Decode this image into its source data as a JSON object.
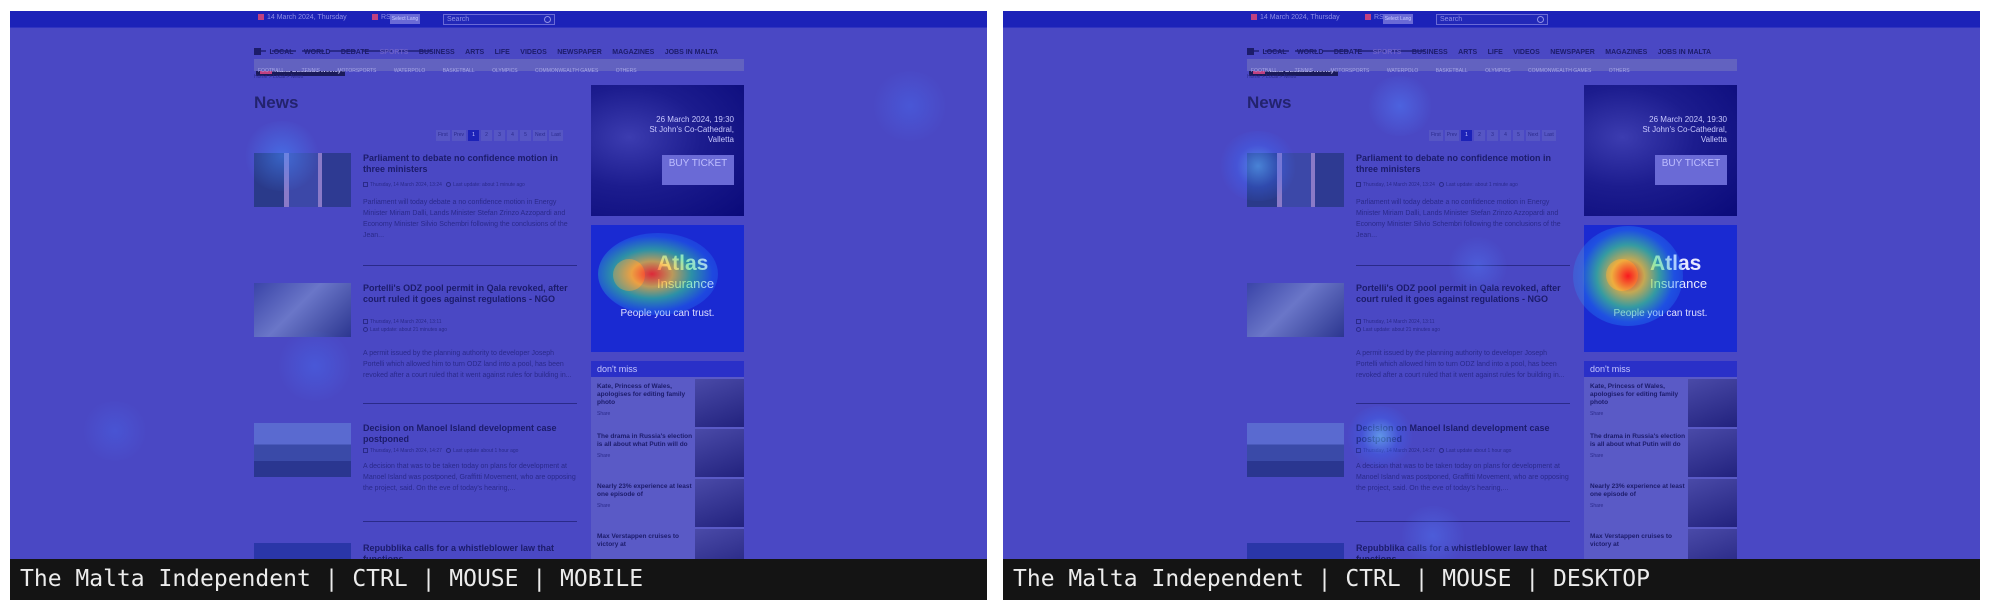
{
  "site": {
    "topbar": {
      "date": "14 March 2024, Thursday",
      "rss": "RSS",
      "translate": "Select Lang",
      "search_placeholder": "Search"
    },
    "nav": {
      "items": [
        "LOCAL",
        "WORLD",
        "DEBATE",
        "SPORTS",
        "BUSINESS",
        "ARTS",
        "LIFE",
        "VIDEOS",
        "NEWSPAPER",
        "MAGAZINES",
        "JOBS IN MALTA"
      ],
      "promo": "Malta Business Weekly"
    },
    "subnav": [
      "FOOTBALL",
      "TENNIS",
      "MOTORSPORTS",
      "WATERPOLO",
      "BASKETBALL",
      "OLYMPICS",
      "COMMONWEALTH GAMES",
      "OTHERS"
    ],
    "breadcrumb": "Home > Local > News",
    "heading": "News",
    "pager": [
      "First",
      "Prev",
      "1",
      "2",
      "3",
      "4",
      "5",
      "Next",
      "Last"
    ],
    "pager_current": "1",
    "articles": [
      {
        "title": "Parliament to debate no confidence motion in three ministers",
        "date": "Thursday, 14 March 2024, 13:24",
        "updated": "Last update: about 1 minute ago",
        "lead": "Parliament will today debate a no confidence motion in Energy Minister Miriam Dalli, Lands Minister Stefan Zrinzo Azzopardi and Economy Minister Silvio Schembri following the conclusions of the Jean..."
      },
      {
        "title": "Portelli's ODZ pool permit in Qala revoked, after court ruled it goes against regulations - NGO",
        "date": "Thursday, 14 March 2024, 13:11",
        "updated": "Last update: about 21 minutes ago",
        "lead": "A permit issued by the planning authority to developer Joseph Portelli which allowed him to turn ODZ land into a pool, has been revoked after a court ruled that it went against rules for building in..."
      },
      {
        "title": "Decision on Manoel Island development case postponed",
        "date": "Thursday, 14 March 2024, 14:27",
        "updated": "Last update about 1 hour ago",
        "lead": "A decision that was to be taken today on plans for development at Manoel Island was postponed, Graffitti Movement, who are opposing the project, said. On the eve of today's hearing,..."
      },
      {
        "title": "Repubblika calls for a whistleblower law that functions",
        "date": "",
        "updated": "",
        "lead": ""
      }
    ],
    "ad_concert": {
      "date": "26 March 2024, 19:30",
      "venue": "St John's Co-Cathedral, Valletta",
      "button": "BUY TICKET"
    },
    "ad_insurance": {
      "brand": "Atlas",
      "brand_sub": "Insurance",
      "tagline": "People you can trust."
    },
    "dont_miss": {
      "header": "don't miss",
      "share": "Share",
      "items": [
        "Kate, Princess of Wales, apologises for editing family photo",
        "The drama in Russia's election is all about what Putin will do",
        "Nearly 23% experience at least one episode of",
        "Max Verstappen cruises to victory at"
      ]
    }
  },
  "captions": {
    "left": "The Malta Independent | CTRL | MOUSE | MOBILE",
    "right": "The Malta Independent | CTRL | MOUSE | DESKTOP"
  }
}
